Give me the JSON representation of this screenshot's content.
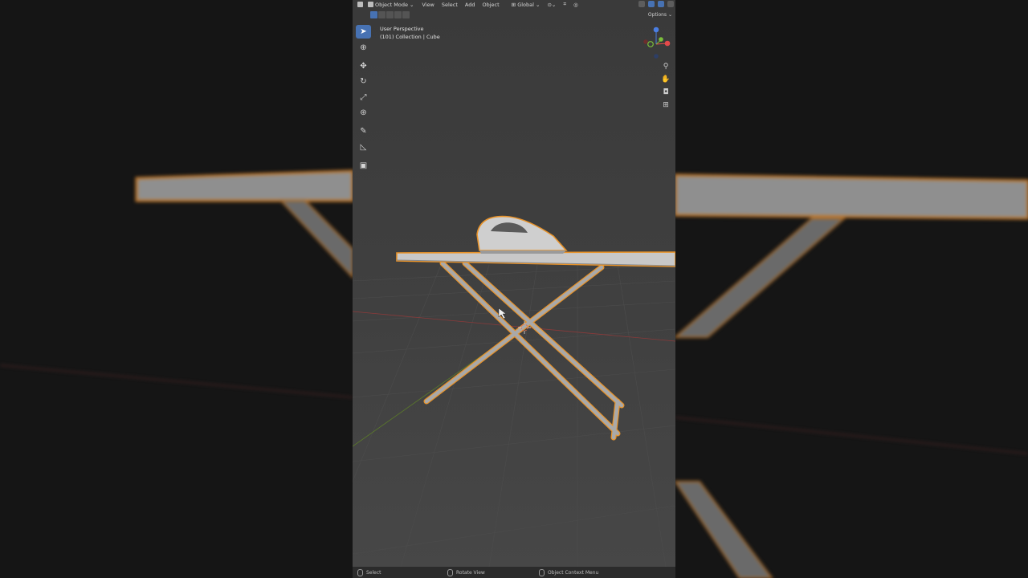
{
  "header": {
    "mode": "Object Mode",
    "menus": [
      "View",
      "Select",
      "Add",
      "Object"
    ],
    "orientation": "Global"
  },
  "viewport": {
    "view_name": "User Perspective",
    "collection_info": "(101) Collection | Cube",
    "options_label": "Options"
  },
  "toolbar": {
    "tools": [
      "select-box",
      "cursor",
      "move",
      "rotate",
      "scale",
      "transform",
      "annotate",
      "measure",
      "add-cube"
    ],
    "active_tool": "select-box"
  },
  "gizmo": {
    "x_color": "#e34a4a",
    "y_color": "#7bbf3b",
    "z_color": "#4a7ee3"
  },
  "statusbar": {
    "select": "Select",
    "rotate": "Rotate View",
    "context": "Object Context Menu"
  },
  "colors": {
    "selection_outline": "#e8932a",
    "active_tool": "#4772b3"
  }
}
